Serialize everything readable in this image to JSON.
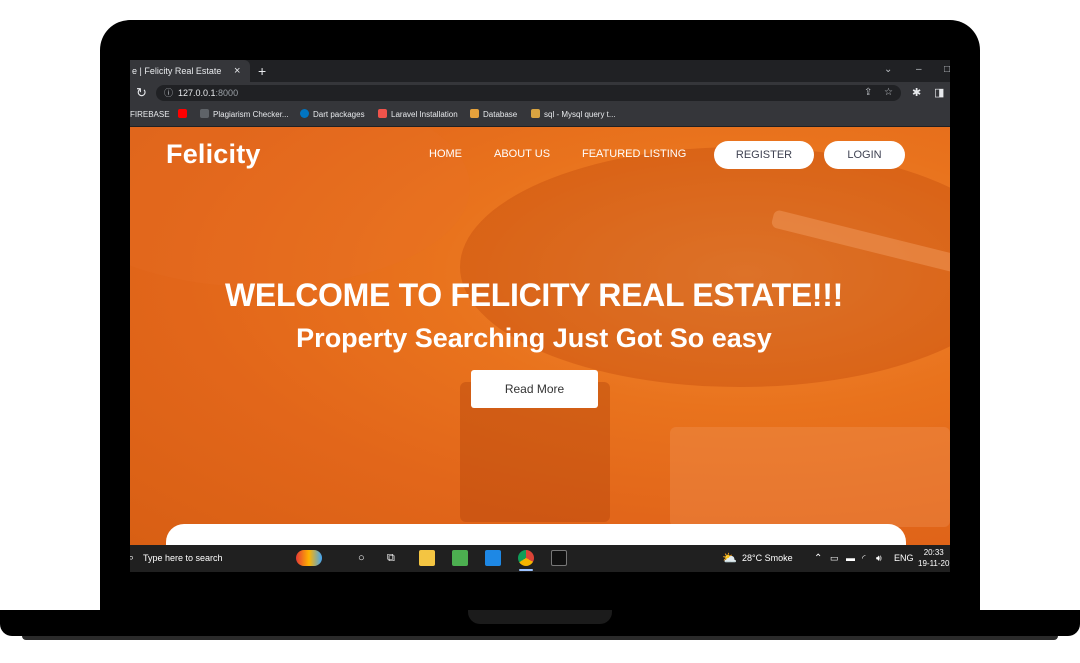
{
  "browser": {
    "tab_title": "e | Felicity Real Estate",
    "tab_close": "×",
    "new_tab": "+",
    "window_controls": {
      "chevron": "⌄",
      "minimize": "–",
      "maximize": "□"
    },
    "url_host": "127.0.0.1",
    "url_port": ":8000",
    "bookmarks": [
      "FIREBASE",
      "Plagiarism Checker...",
      "Dart packages",
      "Laravel Installation",
      "Database",
      "sql - Mysql query t..."
    ]
  },
  "site": {
    "logo": "Felicity",
    "nav": {
      "home": "HOME",
      "about": "ABOUT US",
      "featured": "FEATURED LISTING",
      "register": "REGISTER",
      "login": "LOGIN"
    },
    "hero_title": "WELCOME TO FELICITY REAL ESTATE!!!",
    "hero_subtitle": "Property Searching Just Got So easy",
    "read_more": "Read More",
    "accent_color": "#e9731d"
  },
  "taskbar": {
    "search_placeholder": "Type here to search",
    "weather": "28°C  Smoke",
    "language": "ENG",
    "time": "20:33",
    "date": "19-11-20"
  }
}
